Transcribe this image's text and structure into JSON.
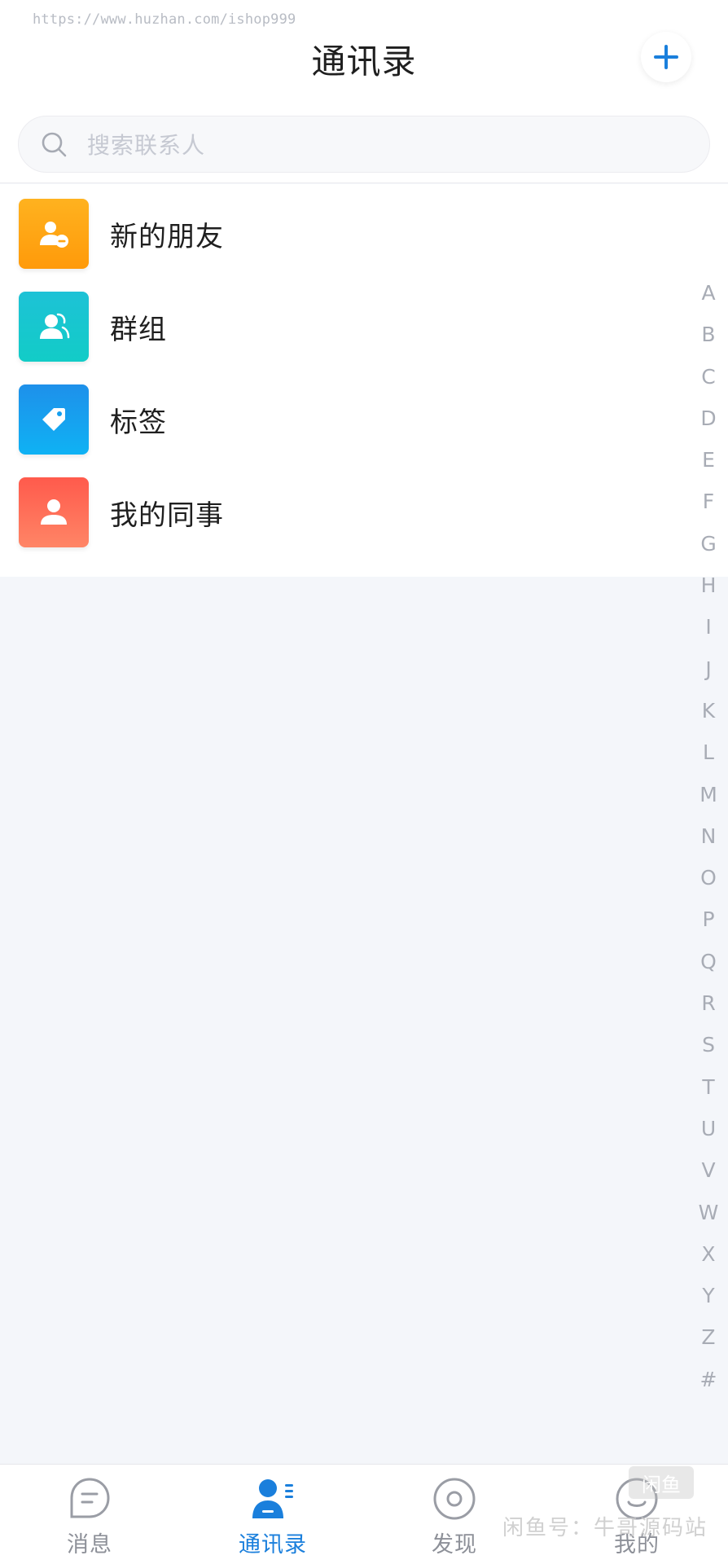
{
  "watermark_url": "https://www.huzhan.com/ishop999",
  "header": {
    "title": "通讯录",
    "add_icon": "plus-icon"
  },
  "search": {
    "placeholder": "搜索联系人",
    "icon": "search-icon"
  },
  "list": {
    "items": [
      {
        "label": "新的朋友",
        "icon": "new-friend-icon",
        "color": "#ffa512"
      },
      {
        "label": "群组",
        "icon": "group-icon",
        "color": "#16c7cf"
      },
      {
        "label": "标签",
        "icon": "tag-icon",
        "color": "#169fef"
      },
      {
        "label": "我的同事",
        "icon": "colleague-icon",
        "color": "#ff6e58"
      }
    ]
  },
  "alphabet": [
    "A",
    "B",
    "C",
    "D",
    "E",
    "F",
    "G",
    "H",
    "I",
    "J",
    "K",
    "L",
    "M",
    "N",
    "O",
    "P",
    "Q",
    "R",
    "S",
    "T",
    "U",
    "V",
    "W",
    "X",
    "Y",
    "Z",
    "#"
  ],
  "tabbar": {
    "tabs": [
      {
        "label": "消息",
        "icon": "message-icon",
        "active": false
      },
      {
        "label": "通讯录",
        "icon": "contacts-icon",
        "active": true
      },
      {
        "label": "发现",
        "icon": "discover-icon",
        "active": false
      },
      {
        "label": "我的",
        "icon": "profile-icon",
        "active": false
      }
    ],
    "active_color": "#1a7fdc",
    "inactive_color": "#8d9098"
  },
  "overlay": {
    "badge": "闲鱼",
    "watermark": "闲鱼号：牛哥源码站"
  }
}
